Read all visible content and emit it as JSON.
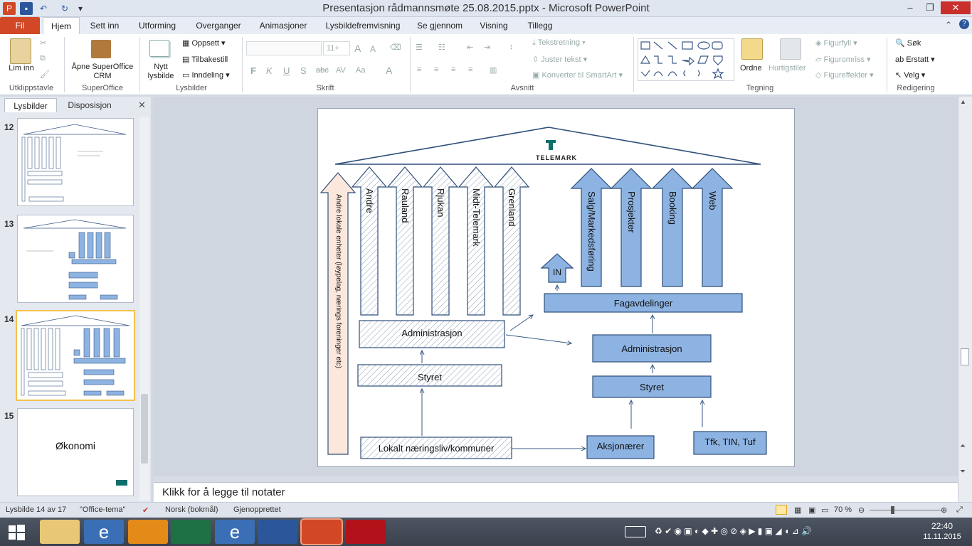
{
  "window": {
    "title": "Presentasjon rådmannsmøte 25.08.2015.pptx  -  Microsoft PowerPoint"
  },
  "tabs": [
    "Fil",
    "Hjem",
    "Sett inn",
    "Utforming",
    "Overganger",
    "Animasjoner",
    "Lysbildefremvisning",
    "Se gjennom",
    "Visning",
    "Tillegg"
  ],
  "ribbon": {
    "utklipp": {
      "paste": "Lim inn",
      "label": "Utklippstavle"
    },
    "superoffice": {
      "open": "Åpne SuperOffice CRM",
      "label": "SuperOffice"
    },
    "lysbilder": {
      "new": "Nytt lysbilde",
      "layout": "Oppsett",
      "reset": "Tilbakestill",
      "section": "Inndeling",
      "label": "Lysbilder"
    },
    "skrift": {
      "size": "11+",
      "label": "Skrift"
    },
    "avsnitt": {
      "textdir": "Tekstretning",
      "align": "Juster tekst",
      "smartart": "Konverter til SmartArt",
      "label": "Avsnitt"
    },
    "tegning": {
      "arrange": "Ordne",
      "quickstyles": "Hurtigstiler",
      "fill": "Figurfyll",
      "outline": "Figuromriss",
      "effects": "Figureffekter",
      "label": "Tegning"
    },
    "redigering": {
      "find": "Søk",
      "replace": "Erstatt",
      "select": "Velg",
      "label": "Redigering"
    }
  },
  "pane": {
    "tab1": "Lysbilder",
    "tab2": "Disposisjon",
    "slides": [
      {
        "num": "12"
      },
      {
        "num": "13"
      },
      {
        "num": "14"
      },
      {
        "num": "15",
        "text": "Økonomi"
      }
    ]
  },
  "slide": {
    "brand": "TELEMARK",
    "left_arrows": [
      "Andre",
      "Rauland",
      "Rjukan",
      "Midt-Telemark",
      "Grenland"
    ],
    "tall_arrow": "Andre lokale enheter (løypelag, nærings foreninger etc)",
    "left_admin": "Administrasjon",
    "left_board": "Styret",
    "left_local": "Lokalt næringsliv/kommuner",
    "right_arrows": [
      "Salg/Markedsføring",
      "Prosjekter",
      "Booking",
      "Web"
    ],
    "in": "IN",
    "fagavdelinger": "Fagavdelinger",
    "right_admin": "Administrasjon",
    "right_board": "Styret",
    "aksjonaerer": "Aksjonærer",
    "tfk": "Tfk, TIN, Tuf"
  },
  "notes": "Klikk for å legge til notater",
  "status": {
    "slide": "Lysbilde 14 av 17",
    "theme": "\"Office-tema\"",
    "lang": "Norsk (bokmål)",
    "restore": "Gjenopprettet",
    "zoom": "70 %"
  },
  "taskbar": {
    "time": "22:40",
    "date": "11.11.2015"
  },
  "colors": {
    "blue_fill": "#8db3e2",
    "blue_stroke": "#2f4f7a",
    "tall_arrow": "#fbe7dc",
    "file_tab": "#d24726"
  }
}
